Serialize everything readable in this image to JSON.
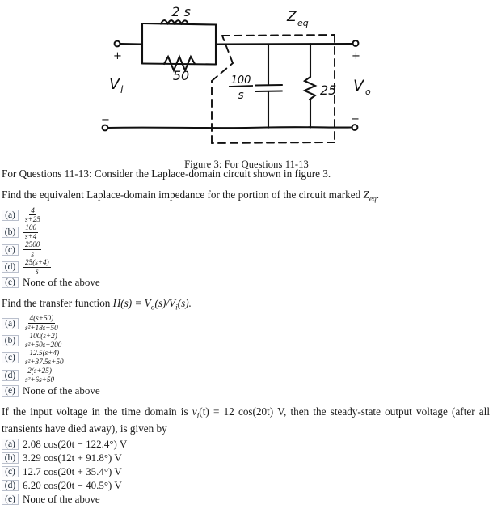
{
  "figure": {
    "caption": "Figure 3:  For Questions 11-13",
    "labels": {
      "inductor": "2 s",
      "resistor_series": "50",
      "capacitor_num": "100",
      "capacitor_den": "s",
      "resistor_shunt": "25",
      "zeq": "Z",
      "zeq_sub": "eq",
      "vin": "V",
      "vin_sub": "i",
      "vout": "V",
      "vout_sub": "o",
      "plus_left": "+",
      "minus_left": "−",
      "plus_right": "+",
      "minus_right": "−"
    }
  },
  "intro": {
    "text_a": "For Questions 11-13:  Consider the Laplace-domain circuit shown in figure 3."
  },
  "questions": [
    {
      "id": "q11",
      "prompt_parts": {
        "a": "Find the equivalent Laplace-domain impedance for the portion of the circuit marked ",
        "sym": "Z",
        "sub": "eq",
        "b": "."
      },
      "options": [
        {
          "label": "(a)",
          "kind": "frac",
          "num": "4",
          "den": "s+25"
        },
        {
          "label": "(b)",
          "kind": "frac",
          "num": "100",
          "den": "s+4"
        },
        {
          "label": "(c)",
          "kind": "frac",
          "num": "2500",
          "den": "s"
        },
        {
          "label": "(d)",
          "kind": "frac",
          "num": "25(s+4)",
          "den": "s"
        },
        {
          "label": "(e)",
          "kind": "text",
          "text": "None of the above"
        }
      ]
    },
    {
      "id": "q12",
      "prompt_parts": {
        "a": "Find the transfer function ",
        "sym": "H",
        "sub": "",
        "b": "(s) = V",
        "c": "o",
        "d": "(s)/V",
        "e": "i",
        "f": "(s)."
      },
      "options": [
        {
          "label": "(a)",
          "kind": "frac",
          "num": "4(s+50)",
          "den": "s²+18s+50"
        },
        {
          "label": "(b)",
          "kind": "frac",
          "num": "100(s+2)",
          "den": "s²+50s+200"
        },
        {
          "label": "(c)",
          "kind": "frac",
          "num": "12.5(s+4)",
          "den": "s²+37.5s+50"
        },
        {
          "label": "(d)",
          "kind": "frac",
          "num": "2(s+25)",
          "den": "s²+6s+50"
        },
        {
          "label": "(e)",
          "kind": "text",
          "text": "None of the above"
        }
      ]
    },
    {
      "id": "q13",
      "prompt_parts": {
        "a": "If the input voltage in the time domain is ",
        "v": "v",
        "vsub": "i",
        "b": "(t) = 12 cos(20t) V, then the steady-state output voltage (after all transients have died away), is given by"
      },
      "options": [
        {
          "label": "(a)",
          "kind": "text",
          "text": "2.08 cos(20t − 122.4°) V"
        },
        {
          "label": "(b)",
          "kind": "text",
          "text": "3.29 cos(12t + 91.8°) V"
        },
        {
          "label": "(c)",
          "kind": "text",
          "text": "12.7 cos(20t + 35.4°) V"
        },
        {
          "label": "(d)",
          "kind": "text",
          "text": "6.20 cos(20t − 40.5°) V"
        },
        {
          "label": "(e)",
          "kind": "text",
          "text": "None of the above"
        }
      ]
    }
  ],
  "colors": {
    "ink": "#1a1a1a",
    "box_border": "#b9bfcc",
    "box_fill": "#fbfbfd"
  }
}
